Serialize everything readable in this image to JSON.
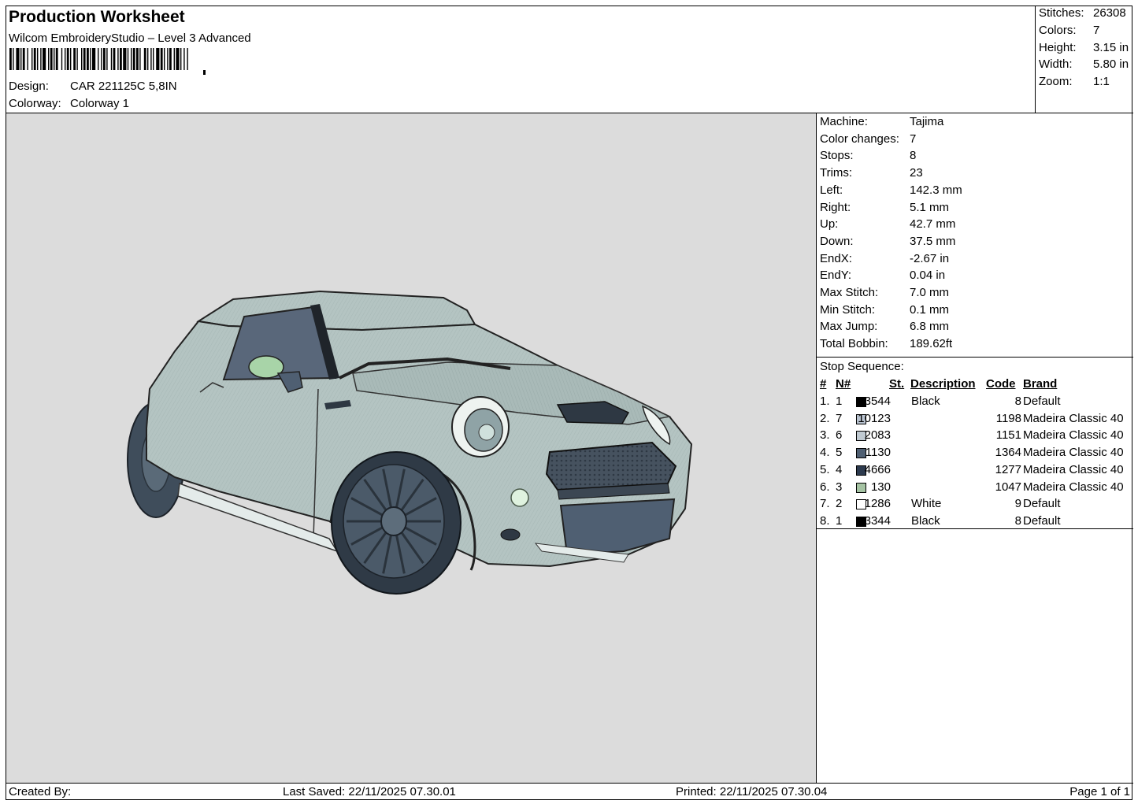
{
  "header": {
    "title": "Production Worksheet",
    "software": "Wilcom EmbroideryStudio – Level 3 Advanced",
    "design_label": "Design:",
    "design_value": "CAR 221125C 5,8IN",
    "colorway_label": "Colorway:",
    "colorway_value": "Colorway 1"
  },
  "summary": {
    "stitches_label": "Stitches:",
    "stitches_value": "26308",
    "colors_label": "Colors:",
    "colors_value": "7",
    "height_label": "Height:",
    "height_value": "3.15 in",
    "width_label": "Width:",
    "width_value": "5.80 in",
    "zoom_label": "Zoom:",
    "zoom_value": "1:1"
  },
  "machine": [
    {
      "label": "Machine:",
      "value": "Tajima"
    },
    {
      "label": "Color changes:",
      "value": "7"
    },
    {
      "label": "Stops:",
      "value": "8"
    },
    {
      "label": "Trims:",
      "value": "23"
    },
    {
      "label": "Left:",
      "value": "142.3 mm"
    },
    {
      "label": "Right:",
      "value": "5.1 mm"
    },
    {
      "label": "Up:",
      "value": "42.7 mm"
    },
    {
      "label": "Down:",
      "value": "37.5 mm"
    },
    {
      "label": "EndX:",
      "value": "-2.67 in"
    },
    {
      "label": "EndY:",
      "value": "0.04 in"
    },
    {
      "label": "Max Stitch:",
      "value": "7.0 mm"
    },
    {
      "label": "Min Stitch:",
      "value": "0.1 mm"
    },
    {
      "label": "Max Jump:",
      "value": "6.8 mm"
    },
    {
      "label": "Total Bobbin:",
      "value": "189.62ft"
    }
  ],
  "stop_sequence": {
    "title": "Stop Sequence:",
    "columns": {
      "num": "#",
      "n": "N#",
      "st": "St.",
      "desc": "Description",
      "code": "Code",
      "brand": "Brand"
    },
    "rows": [
      {
        "num": "1.",
        "n": "1",
        "color": "#000000",
        "st": "3544",
        "desc": "Black",
        "code": "8",
        "brand": "Default"
      },
      {
        "num": "2.",
        "n": "7",
        "color": "#b9c3d0",
        "st": "10123",
        "desc": "",
        "code": "1198",
        "brand": "Madeira Classic 40"
      },
      {
        "num": "3.",
        "n": "6",
        "color": "#c0cad2",
        "st": "2083",
        "desc": "",
        "code": "1151",
        "brand": "Madeira Classic 40"
      },
      {
        "num": "4.",
        "n": "5",
        "color": "#4f5f72",
        "st": "1130",
        "desc": "",
        "code": "1364",
        "brand": "Madeira Classic 40"
      },
      {
        "num": "5.",
        "n": "4",
        "color": "#2c3a4e",
        "st": "4666",
        "desc": "",
        "code": "1277",
        "brand": "Madeira Classic 40"
      },
      {
        "num": "6.",
        "n": "3",
        "color": "#a5c3a3",
        "st": "130",
        "desc": "",
        "code": "1047",
        "brand": "Madeira Classic 40"
      },
      {
        "num": "7.",
        "n": "2",
        "color": "#ffffff",
        "st": "1286",
        "desc": "White",
        "code": "9",
        "brand": "Default"
      },
      {
        "num": "8.",
        "n": "1",
        "color": "#000000",
        "st": "3344",
        "desc": "Black",
        "code": "8",
        "brand": "Default"
      }
    ]
  },
  "footer": {
    "created_by": "Created By:",
    "last_saved": "Last Saved: 22/11/2025 07.30.01",
    "printed": "Printed: 22/11/2025 07.30.04",
    "page": "Page 1 of 1"
  },
  "design_colors": {
    "background": "#dcdcdc",
    "body": "#b4c4c2",
    "window": "#59677a",
    "wheel": "#3f4d5b",
    "headlight": "#a8d4a8"
  }
}
